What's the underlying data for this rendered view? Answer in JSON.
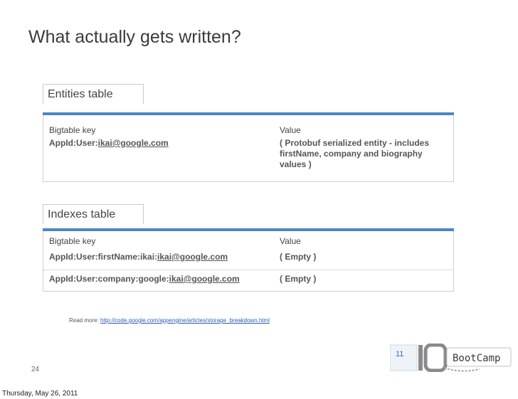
{
  "title": "What actually gets written?",
  "entities": {
    "label": "Entities table",
    "header": {
      "key": "Bigtable key",
      "value": "Value"
    },
    "row": {
      "key_prefix": "AppId:User:",
      "key_email": "ikai@google.com",
      "value_lines": [
        "( Protobuf serialized entity - includes",
        "firstName, company and biography",
        "values )"
      ]
    }
  },
  "indexes": {
    "label": "Indexes table",
    "header": {
      "key": "Bigtable key",
      "value": "Value"
    },
    "rows": [
      {
        "key_prefix": "AppId:User:firstName:ikai:",
        "key_email": "ikai@google.com",
        "value": "( Empty )"
      },
      {
        "key_prefix": "AppId:User:company:google:",
        "key_email": "ikai@google.com",
        "value": "( Empty )"
      }
    ]
  },
  "read_more": {
    "label": "Read more:",
    "url": "http://code.google.com/appengine/articles/storage_breakdown.html"
  },
  "slide_number": "24",
  "footer_date": "Thursday, May 26, 2011",
  "logo": {
    "text": "BootCamp",
    "number": "11",
    "colors": {
      "blue": "#2f6fb3",
      "gray": "#8a8a8a"
    }
  }
}
